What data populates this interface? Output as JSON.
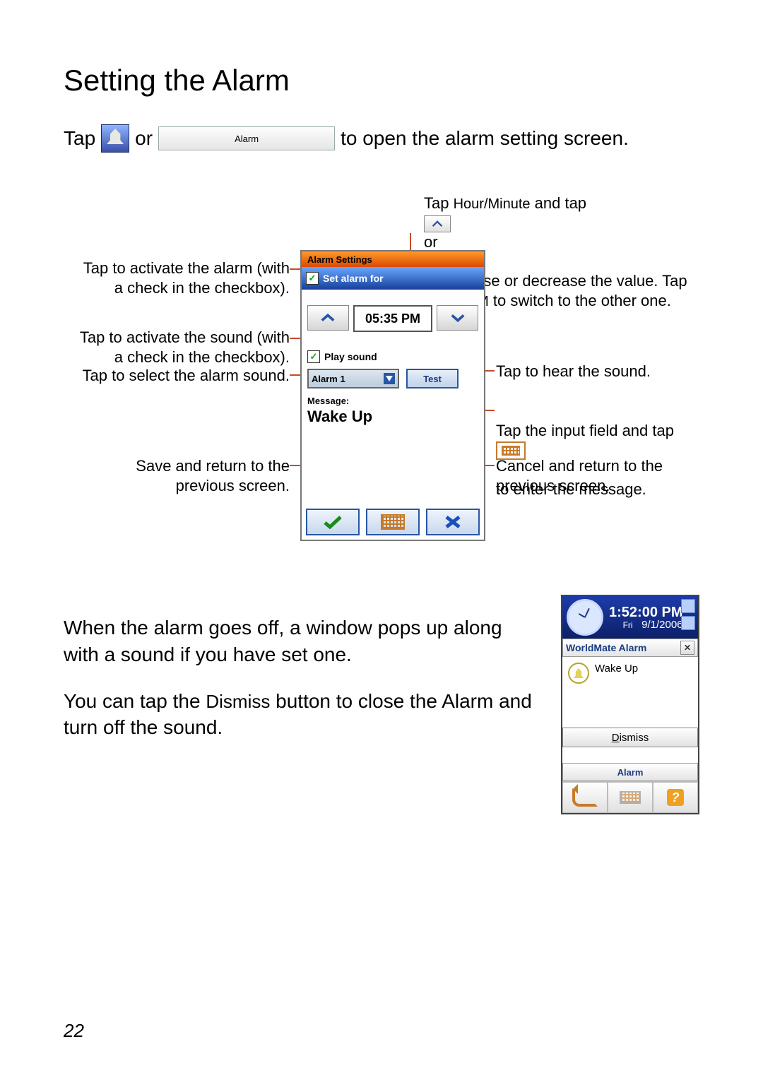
{
  "title": "Setting the Alarm",
  "intro": {
    "tap": "Tap",
    "or": "or",
    "rest": "to open the alarm setting screen.",
    "alarm_btn": "Alarm"
  },
  "callouts": {
    "top": "Tap Hour/Minute and tap          or          to\nincrease or decrease the value. Tap AM\nor PM to switch to the other one.",
    "l1": "Tap to activate the alarm (with\na check in the checkbox).",
    "l2": "Tap to activate the sound (with\na check in the checkbox).",
    "l3": "Tap to select the alarm sound.",
    "l4": "Save and return to the\nprevious screen.",
    "r1": "Tap to hear the sound.",
    "r2a": "Tap the input field and tap",
    "r2b": "to enter the message.",
    "r3": "Cancel and return to the\nprevious screen."
  },
  "device": {
    "title": "Alarm Settings",
    "set_label": "Set alarm for",
    "time": "05:35 PM",
    "play_label": "Play sound",
    "sound_name": "Alarm 1",
    "test": "Test",
    "msg_label": "Message:",
    "msg_value": "Wake Up"
  },
  "para1": "When the alarm goes off, a window pops up along with a sound if you have set one.",
  "para2a": "You can tap the ",
  "para2b": "Dismiss",
  "para2c": " button to close the Alarm and turn off the sound.",
  "popup": {
    "time": "1:52:00 PM",
    "day": "Fri",
    "date": "9/1/2006",
    "bar": "WorldMate Alarm",
    "msg": "Wake Up",
    "dismiss": "Dismiss",
    "alarm": "Alarm"
  },
  "page_number": "22"
}
